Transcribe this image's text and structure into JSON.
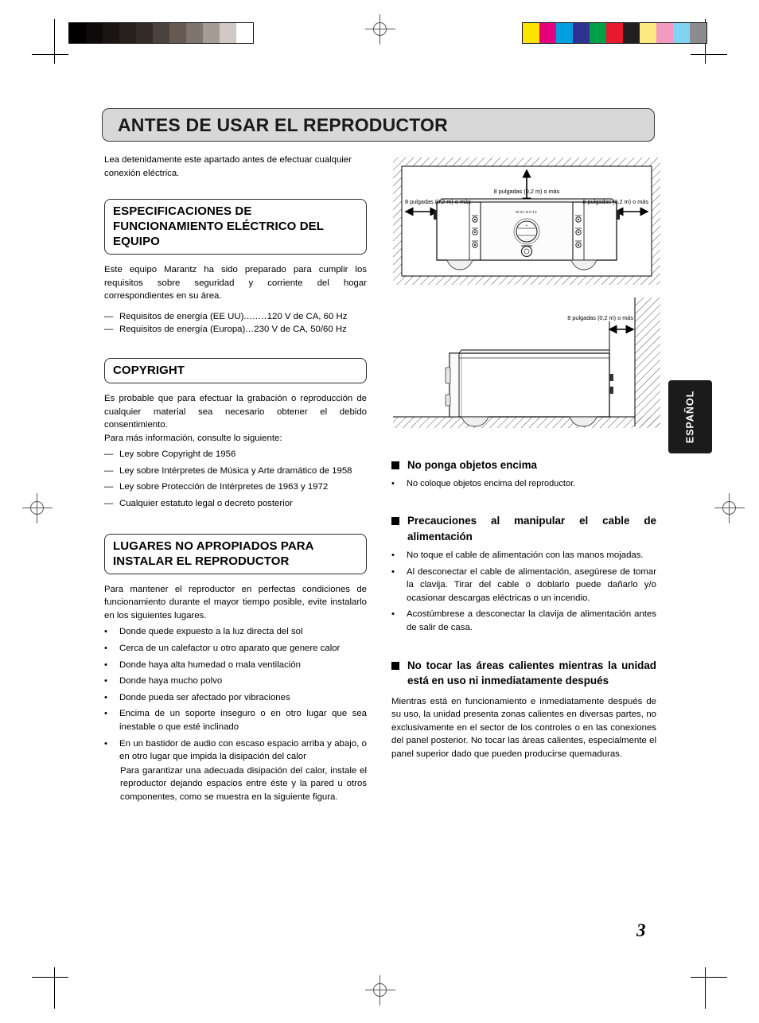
{
  "document": {
    "page_number": "3",
    "language_tab": "ESPAÑOL",
    "title": "ANTES DE USAR EL REPRODUCTOR",
    "intro": "Lea detenidamente este apartado antes de efectuar cualquier conexión eléctrica."
  },
  "print_marks": {
    "grayscale_patches": [
      "#000000",
      "#0d0a09",
      "#1a1513",
      "#26201d",
      "#332b27",
      "#4c423d",
      "#665a53",
      "#80756e",
      "#a69c96",
      "#d0c8c4",
      "#ffffff"
    ],
    "color_patches": [
      "#ffe400",
      "#e5007e",
      "#00a0e0",
      "#2e3192",
      "#00a04a",
      "#e8192c",
      "#231f20",
      "#faea80",
      "#f49ac1",
      "#7fd4f2",
      "#8c8c8c"
    ],
    "registration_icon": "registration-crosshair-icon"
  },
  "left_column": {
    "section_power": {
      "heading": "ESPECIFICACIONES DE FUNCIONAMIENTO ELÉCTRICO DEL EQUIPO",
      "body": "Este equipo Marantz ha sido preparado para cumplir los requisitos sobre seguridad y corriente del hogar correspondientes en su área.",
      "specs": [
        {
          "marker": "—",
          "label": "Requisitos de energía (EE UU)",
          "leader": "........",
          "value": "120 V de CA, 60 Hz"
        },
        {
          "marker": "—",
          "label": "Requisitos de energía (Europa)",
          "leader": "...",
          "value": "230 V de CA, 50/60 Hz"
        }
      ]
    },
    "section_copyright": {
      "heading": "COPYRIGHT",
      "body": "Es probable que para efectuar la grabación o reproducción de cualquier material sea necesario obtener el debido consentimiento.",
      "body2": "Para más información, consulte lo siguiente:",
      "items": [
        {
          "marker": "—",
          "text": "Ley sobre Copyright de 1956"
        },
        {
          "marker": "—",
          "text": "Ley sobre Intérpretes de Música y Arte dramático de 1958"
        },
        {
          "marker": "—",
          "text": "Ley sobre Protección de Intérpretes de 1963 y 1972"
        },
        {
          "marker": "—",
          "text": "Cualquier estatuto legal o decreto posterior"
        }
      ]
    },
    "section_placement": {
      "heading": "LUGARES NO APROPIADOS PARA INSTALAR EL REPRODUCTOR",
      "body": "Para mantener el reproductor en perfectas condiciones de funcionamiento durante el mayor tiempo posible, evite instalarlo en los siguientes lugares.",
      "items": [
        {
          "marker": "•",
          "text": "Donde quede expuesto a la luz directa del sol"
        },
        {
          "marker": "•",
          "text": "Cerca de un calefactor u otro aparato que genere calor"
        },
        {
          "marker": "•",
          "text": "Donde haya alta humedad o mala ventilación"
        },
        {
          "marker": "•",
          "text": "Donde haya mucho polvo"
        },
        {
          "marker": "•",
          "text": "Donde pueda ser afectado por vibraciones"
        },
        {
          "marker": "•",
          "text": "Encima de un soporte inseguro o en otro lugar que sea inestable o que esté inclinado"
        },
        {
          "marker": "•",
          "text": "En un bastidor de audio con escaso espacio arriba y abajo, o en otro lugar que impida la disipación del calor"
        }
      ],
      "note": "Para garantizar una adecuada disipación del calor, instale el reproductor dejando espacios entre éste y la pared u otros componentes, como se muestra en la siguiente figura."
    }
  },
  "right_column": {
    "section_no_objects": {
      "heading": "No ponga objetos encima",
      "items": [
        {
          "marker": "•",
          "text": "No coloque objetos encima del reproductor."
        }
      ]
    },
    "section_power_cable": {
      "heading": "Precauciones al manipular el cable de alimentación",
      "items": [
        {
          "marker": "•",
          "text": "No toque el cable de alimentación con las manos mojadas."
        },
        {
          "marker": "•",
          "text": "Al desconectar el cable de alimentación, asegúrese de tomar la clavija. Tirar del cable o doblarlo puede dañarlo y/o ocasionar descargas eléctricas o un incendio."
        },
        {
          "marker": "•",
          "text": "Acostúmbrese a desconectar la clavija de alimentación antes de salir de casa."
        }
      ]
    },
    "section_hot_areas": {
      "heading": "No tocar las áreas calientes mientras la unidad está en uso ni inmediatamente después",
      "body": "Mientras está en funcionamiento e inmediatamente después de su uso, la unidad presenta zonas calientes en diversas partes, no exclusivamente en el sector de los controles o en las conexiones del panel posterior. No tocar las áreas calientes, especialmente el panel superior dado que pueden producirse quemaduras."
    }
  },
  "diagram": {
    "front_view": {
      "label_top": "8 pulgadas (0,2 m) o más",
      "label_left": "8 pulgadas (0,2 m) o más",
      "label_right": "8 pulgadas (0,2 m) o más",
      "device_brand": "marantz"
    },
    "side_view": {
      "label_rear": "8 pulgadas (0,2 m) o más"
    }
  }
}
